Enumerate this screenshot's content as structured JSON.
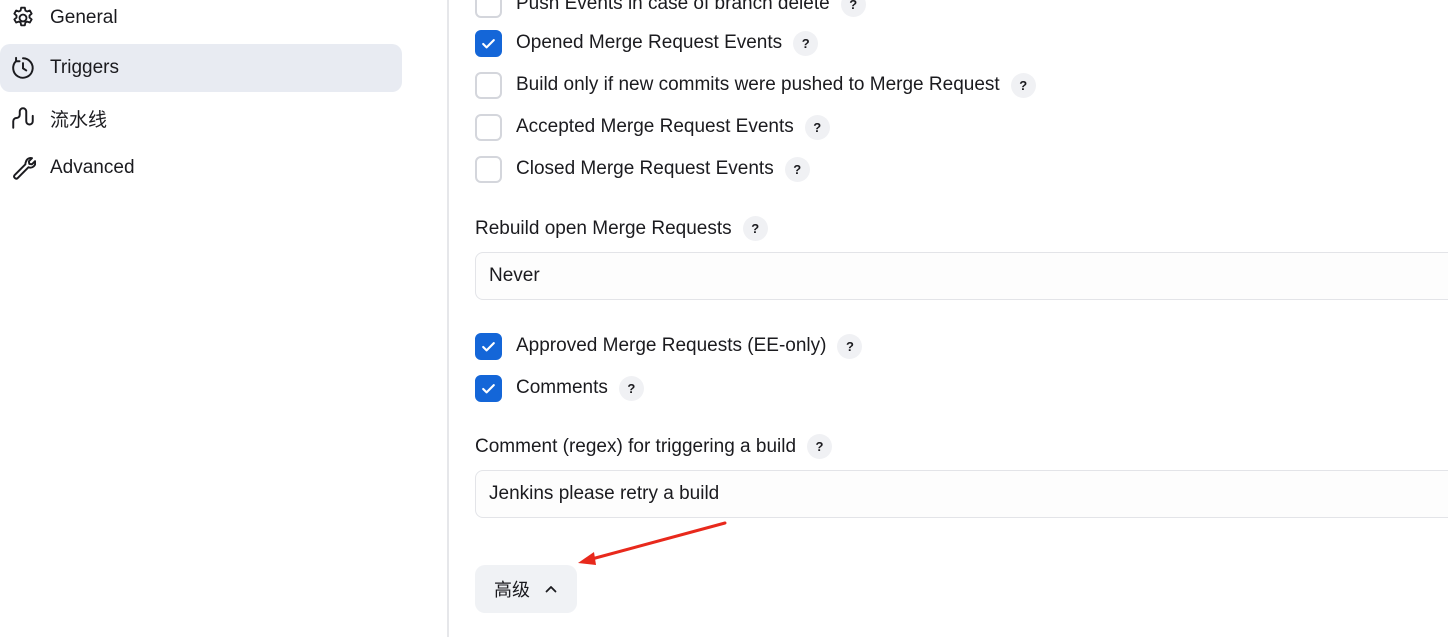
{
  "sidebar": {
    "items": [
      {
        "label": "General",
        "icon": "gear-icon",
        "active": false
      },
      {
        "label": "Triggers",
        "icon": "timer-icon",
        "active": true
      },
      {
        "label": "流水线",
        "icon": "pipeline-icon",
        "active": false
      },
      {
        "label": "Advanced",
        "icon": "wrench-icon",
        "active": false
      }
    ]
  },
  "main": {
    "trigger_options": [
      {
        "label": "Push Events in case of branch delete",
        "checked": false
      },
      {
        "label": "Opened Merge Request Events",
        "checked": true
      },
      {
        "label": "Build only if new commits were pushed to Merge Request",
        "checked": false
      },
      {
        "label": "Accepted Merge Request Events",
        "checked": false
      },
      {
        "label": "Closed Merge Request Events",
        "checked": false
      }
    ],
    "rebuild": {
      "label": "Rebuild open Merge Requests",
      "value": "Never"
    },
    "approval_options": [
      {
        "label": "Approved Merge Requests (EE-only)",
        "checked": true
      },
      {
        "label": "Comments",
        "checked": true
      }
    ],
    "comment_regex": {
      "label": "Comment (regex) for triggering a build",
      "value": "Jenkins please retry a build"
    },
    "advanced_button": {
      "label": "高级",
      "icon": "chevron-up-icon"
    },
    "help_symbol": "?",
    "annotation": {
      "type": "red-arrow",
      "color": "#e8291c"
    }
  },
  "colors": {
    "accent": "#1466d8",
    "active_nav_bg": "#e8ebf2",
    "annotation": "#e8291c"
  }
}
